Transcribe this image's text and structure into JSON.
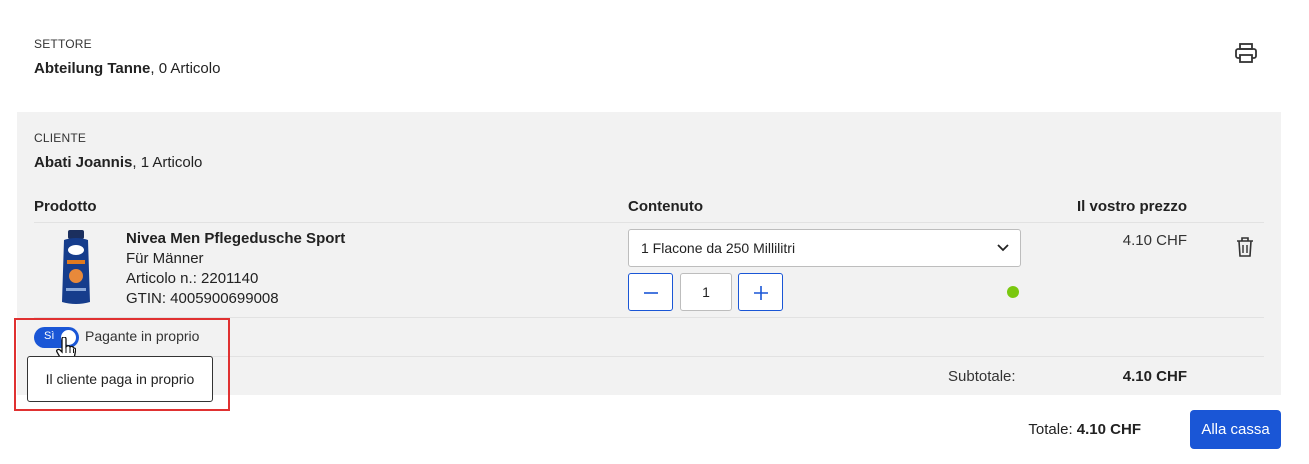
{
  "sector": {
    "label": "SETTORE",
    "name": "Abteilung Tanne",
    "count": ", 0 Articolo"
  },
  "client": {
    "label": "CLIENTE",
    "name": "Abati Joannis",
    "count": ", 1 Articolo"
  },
  "table": {
    "col_product": "Prodotto",
    "col_content": "Contenuto",
    "col_price": "Il vostro prezzo"
  },
  "product": {
    "name": "Nivea Men Pflegedusche Sport",
    "subtitle": "Für Männer",
    "article": "Articolo n.: 2201140",
    "gtin": "GTIN: 4005900699008",
    "content_option": "1 Flacone da 250 Millilitri",
    "quantity": "1",
    "price": "4.10 CHF",
    "stock_status_color": "#7ac80f"
  },
  "self_pay": {
    "toggle_label": "Sì",
    "text": "Pagante in proprio",
    "tooltip": "Il cliente paga in proprio"
  },
  "subtotal": {
    "label": "Subtotale:",
    "value": "4.10 CHF"
  },
  "total": {
    "label": "Totale: ",
    "value": "4.10 CHF"
  },
  "checkout_label": "Alla cassa",
  "icons": {
    "print": "print-icon",
    "trash": "trash-icon",
    "chevron": "chevron-down-icon",
    "minus": "minus-icon",
    "plus": "plus-icon"
  },
  "colors": {
    "accent": "#1a56d6",
    "panel_bg": "#f2f2f2",
    "highlight": "#e03131"
  }
}
